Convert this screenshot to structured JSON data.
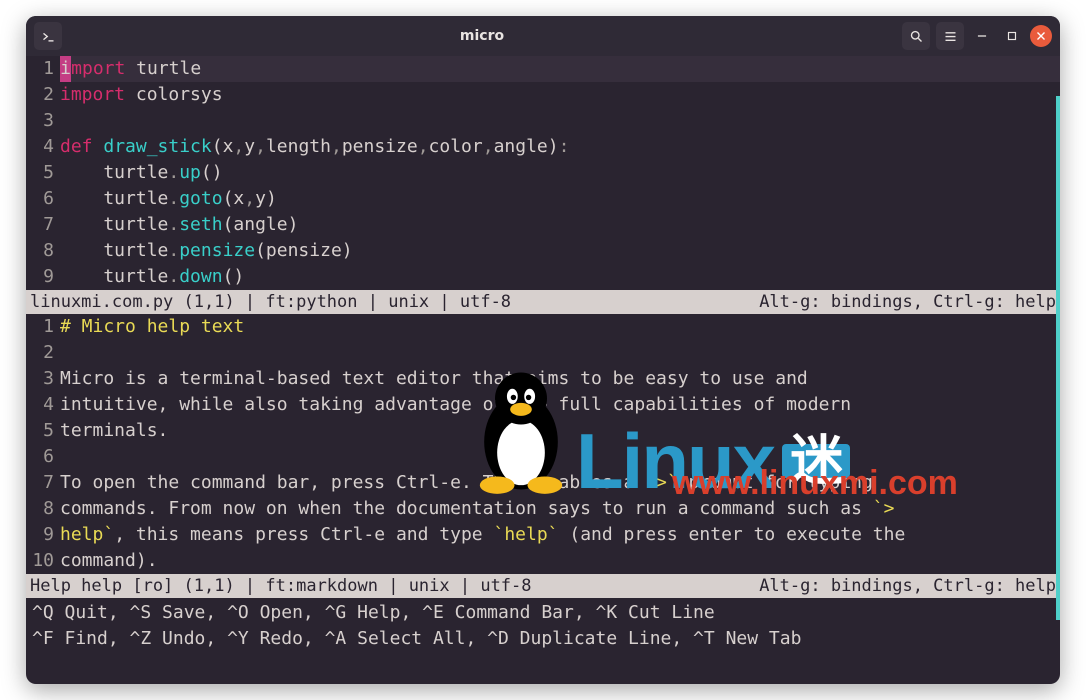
{
  "window": {
    "title": "micro"
  },
  "titlebar_icons": {
    "terminal": "terminal-icon",
    "search": "search-icon",
    "menu": "hamburger-icon",
    "minimize": "minimize-icon",
    "maximize": "maximize-icon",
    "close": "close-icon"
  },
  "pane1": {
    "gutter": [
      "1",
      "2",
      "3",
      "4",
      "5",
      "6",
      "7",
      "8",
      "9"
    ],
    "lines": [
      {
        "tokens": [
          {
            "t": "cursor",
            "v": "i"
          },
          {
            "t": "kw-import",
            "v": "mport"
          },
          {
            "t": "ident",
            "v": " turtle"
          }
        ]
      },
      {
        "tokens": [
          {
            "t": "kw-import",
            "v": "import"
          },
          {
            "t": "ident",
            "v": " colorsys"
          }
        ]
      },
      {
        "tokens": []
      },
      {
        "tokens": [
          {
            "t": "kw-def",
            "v": "def "
          },
          {
            "t": "func",
            "v": "draw_stick"
          },
          {
            "t": "paren",
            "v": "("
          },
          {
            "t": "ident",
            "v": "x"
          },
          {
            "t": "dot",
            "v": ","
          },
          {
            "t": "ident",
            "v": "y"
          },
          {
            "t": "dot",
            "v": ","
          },
          {
            "t": "ident",
            "v": "length"
          },
          {
            "t": "dot",
            "v": ","
          },
          {
            "t": "ident",
            "v": "pensize"
          },
          {
            "t": "dot",
            "v": ","
          },
          {
            "t": "ident",
            "v": "color"
          },
          {
            "t": "dot",
            "v": ","
          },
          {
            "t": "ident",
            "v": "angle"
          },
          {
            "t": "paren",
            "v": ")"
          },
          {
            "t": "dot",
            "v": ":"
          }
        ]
      },
      {
        "tokens": [
          {
            "t": "ident",
            "v": "    turtle"
          },
          {
            "t": "dot",
            "v": "."
          },
          {
            "t": "func",
            "v": "up"
          },
          {
            "t": "paren",
            "v": "()"
          }
        ]
      },
      {
        "tokens": [
          {
            "t": "ident",
            "v": "    turtle"
          },
          {
            "t": "dot",
            "v": "."
          },
          {
            "t": "func",
            "v": "goto"
          },
          {
            "t": "paren",
            "v": "("
          },
          {
            "t": "ident",
            "v": "x"
          },
          {
            "t": "dot",
            "v": ","
          },
          {
            "t": "ident",
            "v": "y"
          },
          {
            "t": "paren",
            "v": ")"
          }
        ]
      },
      {
        "tokens": [
          {
            "t": "ident",
            "v": "    turtle"
          },
          {
            "t": "dot",
            "v": "."
          },
          {
            "t": "func",
            "v": "seth"
          },
          {
            "t": "paren",
            "v": "("
          },
          {
            "t": "ident",
            "v": "angle"
          },
          {
            "t": "paren",
            "v": ")"
          }
        ]
      },
      {
        "tokens": [
          {
            "t": "ident",
            "v": "    turtle"
          },
          {
            "t": "dot",
            "v": "."
          },
          {
            "t": "func",
            "v": "pensize"
          },
          {
            "t": "paren",
            "v": "("
          },
          {
            "t": "ident",
            "v": "pensize"
          },
          {
            "t": "paren",
            "v": ")"
          }
        ]
      },
      {
        "tokens": [
          {
            "t": "ident",
            "v": "    turtle"
          },
          {
            "t": "dot",
            "v": "."
          },
          {
            "t": "func",
            "v": "down"
          },
          {
            "t": "paren",
            "v": "()"
          }
        ]
      }
    ],
    "status_left": "linuxmi.com.py (1,1) | ft:python | unix | utf-8",
    "status_right": "Alt-g: bindings, Ctrl-g: help"
  },
  "pane2": {
    "gutter": [
      "1",
      "2",
      "3",
      "4",
      "5",
      "6",
      "7",
      "8",
      "9",
      "10"
    ],
    "lines": [
      {
        "tokens": [
          {
            "t": "md-head",
            "v": "# Micro help text"
          }
        ]
      },
      {
        "tokens": []
      },
      {
        "tokens": [
          {
            "t": "ident",
            "v": "Micro is a terminal-based text editor that aims to be easy to use and"
          }
        ]
      },
      {
        "tokens": [
          {
            "t": "ident",
            "v": "intuitive, while also taking advantage of the full capabilities of modern"
          }
        ]
      },
      {
        "tokens": [
          {
            "t": "ident",
            "v": "terminals."
          }
        ]
      },
      {
        "tokens": []
      },
      {
        "tokens": [
          {
            "t": "ident",
            "v": "To open the command bar, press Ctrl-e. This enables a "
          },
          {
            "t": "md-code",
            "v": "`>`"
          },
          {
            "t": "ident",
            "v": " prompt for typing"
          }
        ]
      },
      {
        "tokens": [
          {
            "t": "ident",
            "v": "commands. From now on when the documentation says to run a command such as "
          },
          {
            "t": "md-code",
            "v": "`>"
          }
        ]
      },
      {
        "tokens": [
          {
            "t": "md-code",
            "v": "help`"
          },
          {
            "t": "ident",
            "v": ", this means press Ctrl-e and type "
          },
          {
            "t": "md-code",
            "v": "`help`"
          },
          {
            "t": "ident",
            "v": " (and press enter to execute the"
          }
        ]
      },
      {
        "tokens": [
          {
            "t": "ident",
            "v": "command)."
          }
        ]
      }
    ],
    "status_left": "Help help [ro] (1,1) | ft:markdown | unix | utf-8",
    "status_right": "Alt-g: bindings, Ctrl-g: help"
  },
  "footer": {
    "line1": "^Q Quit, ^S Save, ^O Open, ^G Help, ^E Command Bar, ^K Cut Line",
    "line2": "^F Find, ^Z Undo, ^Y Redo, ^A Select All, ^D Duplicate Line, ^T New Tab"
  },
  "overlay": {
    "brand_word": "Linux",
    "brand_box": "迷",
    "url": "www.linuxmi.com"
  }
}
